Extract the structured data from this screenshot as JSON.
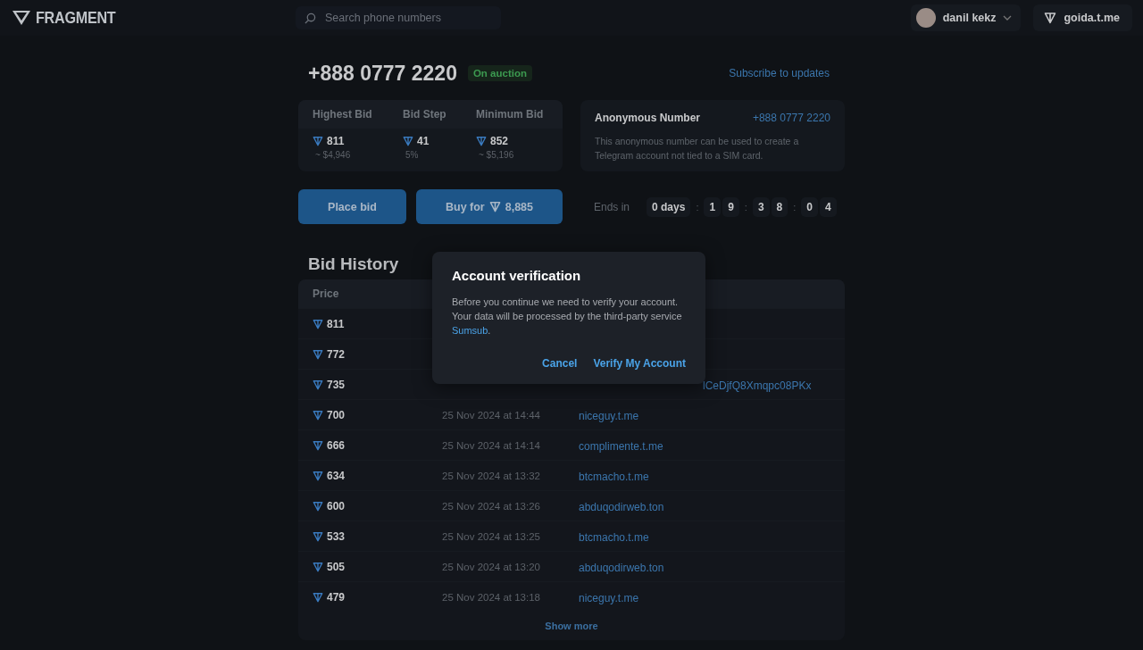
{
  "header": {
    "logo": "FRAGMENT",
    "search": {
      "placeholder": "Search phone numbers"
    },
    "user": {
      "name": "danil kekz"
    },
    "wallet": {
      "label": "goida.t.me"
    }
  },
  "number": {
    "title": "+888 0777 2220",
    "status": "On auction",
    "subscribe": "Subscribe to updates"
  },
  "bid_stats": [
    {
      "label": "Highest Bid",
      "value": "811",
      "sub": "~ $4,946"
    },
    {
      "label": "Bid Step",
      "value": "41",
      "sub": "5%"
    },
    {
      "label": "Minimum Bid",
      "value": "852",
      "sub": "~ $5,196"
    }
  ],
  "info": {
    "title": "Anonymous Number",
    "link": "+888 0777 2220",
    "text": "This anonymous number can be used to create a Telegram account not tied to a SIM card."
  },
  "buttons": {
    "place_bid": "Place bid",
    "buy_prefix": "Buy for",
    "buy_amount": "8,885"
  },
  "countdown": {
    "label": "Ends in",
    "days": "0 days",
    "separator": ":",
    "groups": [
      [
        "1",
        "9"
      ],
      [
        "3",
        "8"
      ],
      [
        "0",
        "4"
      ]
    ]
  },
  "history": {
    "title": "Bid History",
    "columns": [
      "Price"
    ],
    "rows": [
      {
        "price": "811"
      },
      {
        "price": "772"
      },
      {
        "price": "735",
        "bidder_tail": "lCeDjfQ8Xmqpc08PKx"
      },
      {
        "price": "700",
        "date": "25 Nov 2024 at 14:44",
        "bidder": "niceguy.t.me"
      },
      {
        "price": "666",
        "date": "25 Nov 2024 at 14:14",
        "bidder": "complimente.t.me"
      },
      {
        "price": "634",
        "date": "25 Nov 2024 at 13:32",
        "bidder": "btcmacho.t.me"
      },
      {
        "price": "600",
        "date": "25 Nov 2024 at 13:26",
        "bidder": "abduqodirweb.ton"
      },
      {
        "price": "533",
        "date": "25 Nov 2024 at 13:25",
        "bidder": "btcmacho.t.me"
      },
      {
        "price": "505",
        "date": "25 Nov 2024 at 13:20",
        "bidder": "abduqodirweb.ton"
      },
      {
        "price": "479",
        "date": "25 Nov 2024 at 13:18",
        "bidder": "niceguy.t.me"
      }
    ],
    "show_more": "Show more"
  },
  "modal": {
    "title": "Account verification",
    "text": "Before you continue we need to verify your account. Your data will be processed by the third-party service",
    "link": "Sumsub",
    "link_after": ".",
    "buttons": [
      "Cancel",
      "Verify My Account"
    ]
  }
}
